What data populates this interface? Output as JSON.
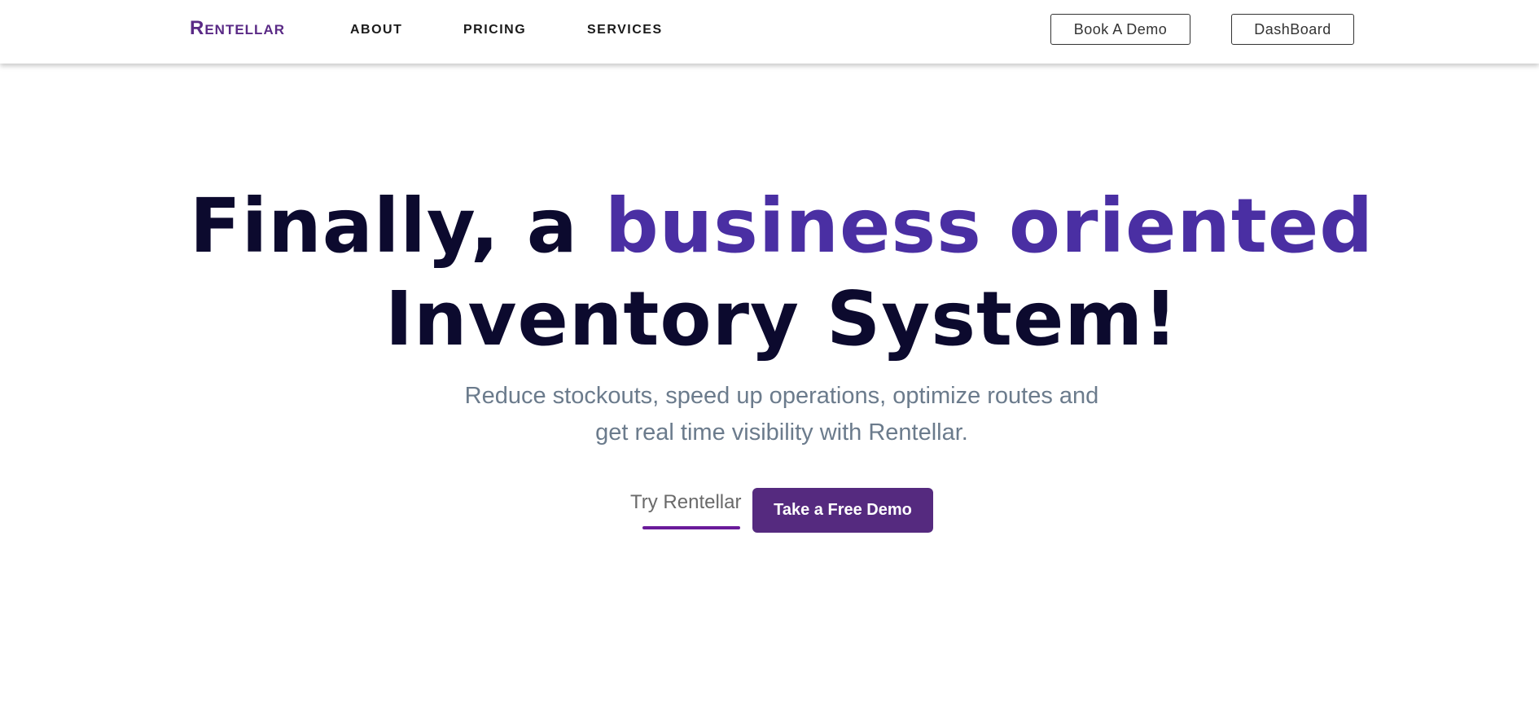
{
  "brand": {
    "logo_text": "Rentellar",
    "color": "#5a2a86"
  },
  "nav": {
    "links": [
      {
        "label": "ABOUT"
      },
      {
        "label": "PRICING"
      },
      {
        "label": "SERVICES"
      }
    ],
    "book_demo_label": "Book A Demo",
    "dashboard_label": "DashBoard"
  },
  "hero": {
    "title_part1": "Finally, a ",
    "title_accent": "business oriented",
    "title_line2": "Inventory System!",
    "subtitle_line1": "Reduce stockouts, speed up operations, optimize routes and",
    "subtitle_line2": "get real time visibility with Rentellar.",
    "accent_color": "#4a2fa3",
    "title_color": "#0c0a2e"
  },
  "cta": {
    "try_label": "Try Rentellar",
    "demo_label": "Take a Free Demo",
    "demo_button_color": "#552a7f",
    "underline_color": "#6a1b9a"
  }
}
